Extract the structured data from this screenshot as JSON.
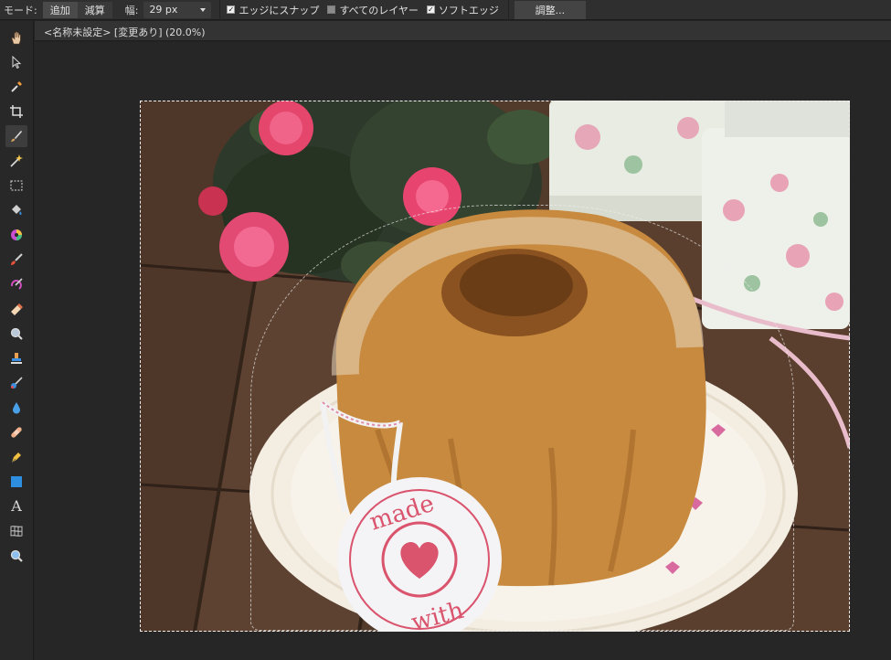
{
  "options_bar": {
    "mode_label": "モード:",
    "mode_add": "追加",
    "mode_subtract": "減算",
    "width_label": "幅:",
    "width_value": "29 px",
    "snap_to_edges": "エッジにスナップ",
    "snap_to_edges_checked": true,
    "all_layers": "すべてのレイヤー",
    "all_layers_checked": false,
    "soft_edge": "ソフトエッジ",
    "soft_edge_checked": true,
    "adjust_button": "調整..."
  },
  "document": {
    "tab_title": "<名称未設定> [変更あり] (20.0%)"
  },
  "tools": [
    {
      "name": "hand-tool",
      "icon": "hand-icon"
    },
    {
      "name": "move-tool",
      "icon": "arrow-pointer-icon"
    },
    {
      "name": "eyedropper-tool",
      "icon": "eyedropper-icon"
    },
    {
      "name": "crop-tool",
      "icon": "crop-icon"
    },
    {
      "name": "refine-selection-tool",
      "icon": "selection-brush-icon",
      "selected": true
    },
    {
      "name": "magic-wand-tool",
      "icon": "magic-wand-icon"
    },
    {
      "name": "marquee-tool",
      "icon": "marquee-icon"
    },
    {
      "name": "fill-tool",
      "icon": "paint-bucket-icon"
    },
    {
      "name": "color-picker-tool",
      "icon": "color-wheel-icon"
    },
    {
      "name": "brush-tool",
      "icon": "paintbrush-icon"
    },
    {
      "name": "color-replace-tool",
      "icon": "color-brush-icon"
    },
    {
      "name": "eraser-tool",
      "icon": "eraser-icon"
    },
    {
      "name": "zoom-lens-tool",
      "icon": "magnifier-icon"
    },
    {
      "name": "clone-stamp-tool",
      "icon": "stamp-icon"
    },
    {
      "name": "smudge-tool",
      "icon": "smudge-icon"
    },
    {
      "name": "blur-tool",
      "icon": "water-drop-icon"
    },
    {
      "name": "healing-tool",
      "icon": "bandage-icon"
    },
    {
      "name": "pen-tool",
      "icon": "pen-nib-icon"
    },
    {
      "name": "shape-tool",
      "icon": "rectangle-icon"
    },
    {
      "name": "text-tool",
      "icon": "text-icon"
    },
    {
      "name": "mesh-warp-tool",
      "icon": "mesh-grid-icon"
    },
    {
      "name": "zoom-tool",
      "icon": "zoom-icon"
    }
  ],
  "canvas": {
    "image": "photo-bundt-cake",
    "tag_text_top": "made",
    "tag_text_bottom": "with"
  },
  "colors": {
    "accent_blue": "#2e8ee0",
    "background": "#232323",
    "panel": "#2f2f2f"
  }
}
